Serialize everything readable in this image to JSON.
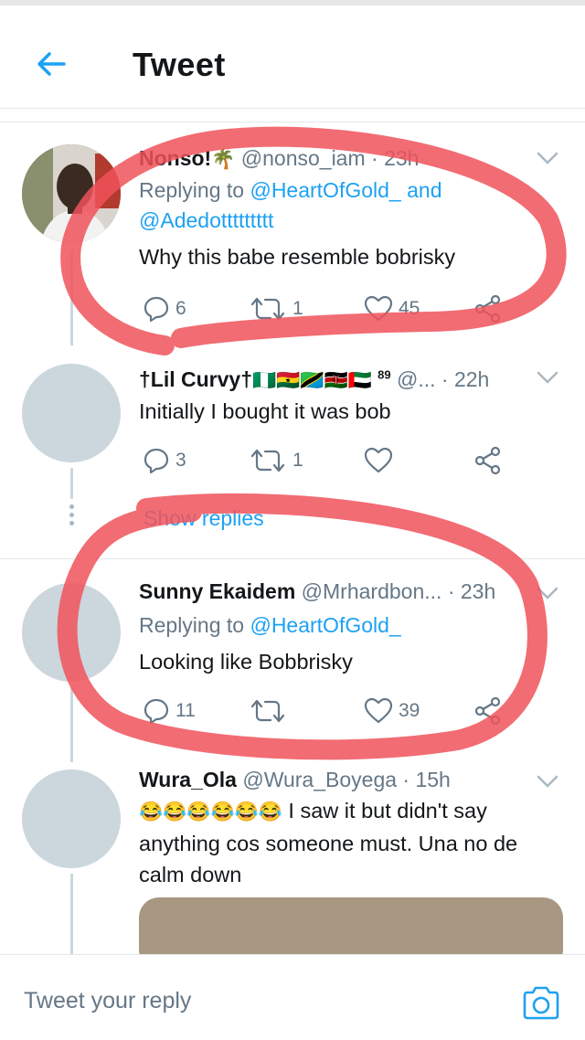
{
  "header": {
    "title": "Tweet"
  },
  "tweets": [
    {
      "name": "Nonso!",
      "name_emoji": "🌴",
      "handle": "@nonso_iam",
      "time": "· 23h",
      "replying_prefix": "Replying to ",
      "replying_to_1": "@HeartOfGold_",
      "replying_and": " and",
      "replying_to_2": "@Adedottttttttt",
      "text": "Why this babe resemble bobrisky",
      "replies": "6",
      "retweets": "1",
      "likes": "45"
    },
    {
      "name": "†Lil Curvy†",
      "flags": "🇳🇬🇬🇭🇹🇿🇰🇪🇦🇪",
      "superscript": "89",
      "handle": "@...",
      "time": "· 22h",
      "text": "Initially I bought it was bob",
      "replies": "3",
      "retweets": "1",
      "likes": ""
    },
    {
      "name": "Sunny Ekaidem",
      "handle": "@Mrhardbon...",
      "time": "· 23h",
      "replying_prefix": "Replying to ",
      "replying_to_1": "@HeartOfGold_",
      "text": "Looking like Bobbrisky",
      "replies": "11",
      "retweets": "",
      "likes": "39"
    },
    {
      "name": "Wura_Ola",
      "handle": "@Wura_Boyega",
      "time": "· 15h",
      "emoji": "😂😂😂😂😂😂",
      "text_line1": " I saw it but didn't say",
      "text_line2": "anything cos someone must. Una no de",
      "text_line3": "calm down"
    }
  ],
  "show_replies": "Show replies",
  "reply_bar": {
    "placeholder": "Tweet your reply"
  },
  "colors": {
    "accent": "#1da1f2",
    "muted": "#657786",
    "highlight": "#f0525a"
  },
  "icons": [
    "back-arrow-icon",
    "chevron-down-icon",
    "reply-icon",
    "retweet-icon",
    "like-icon",
    "share-icon",
    "camera-icon"
  ]
}
